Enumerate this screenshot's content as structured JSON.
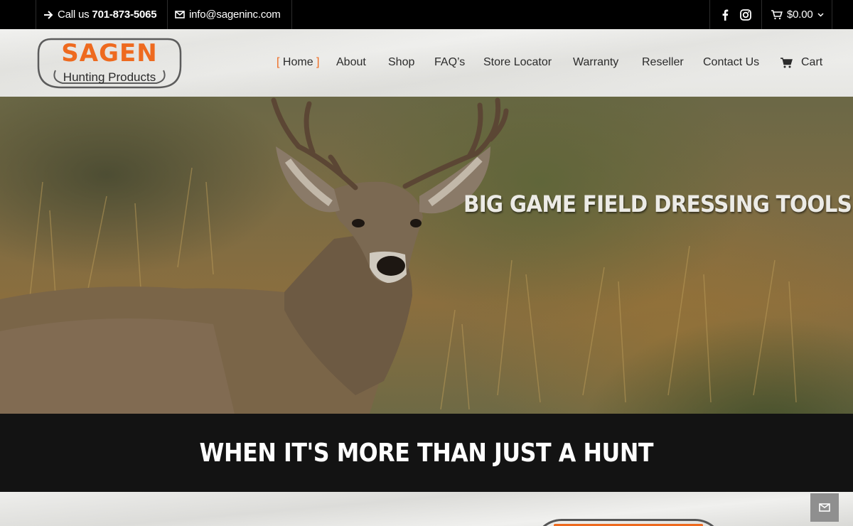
{
  "topbar": {
    "phone_prefix": "Call us",
    "phone_number": "701-873-5065",
    "email": "info@sageninc.com",
    "cart_total": "$0.00",
    "icons": [
      "arrow-right-icon",
      "mail-icon",
      "facebook-icon",
      "instagram-icon",
      "cart-icon",
      "chevron-down-icon"
    ]
  },
  "logo": {
    "brand": "SAGEN",
    "subtitle": "Hunting Products"
  },
  "nav": {
    "items": [
      {
        "label": "Home",
        "active": true
      },
      {
        "label": "About"
      },
      {
        "label": "Shop"
      },
      {
        "label": "FAQ’s"
      },
      {
        "label": "Store Locator"
      },
      {
        "label": "Warranty"
      },
      {
        "label": "Reseller"
      },
      {
        "label": "Contact Us"
      },
      {
        "label": "Cart",
        "icon": "cart-icon"
      }
    ],
    "active_bracket_left": "[",
    "active_bracket_right": "]"
  },
  "hero": {
    "title": "BIG GAME FIELD DRESSING TOOLS"
  },
  "band": {
    "title": "WHEN IT'S MORE THAN JUST A HUNT"
  },
  "colors": {
    "accent": "#ee6a1f",
    "topbar_bg": "#000000",
    "band_bg": "#131313",
    "float_button_bg": "#8f8f8f"
  },
  "float_button": {
    "icon": "mail-icon"
  }
}
